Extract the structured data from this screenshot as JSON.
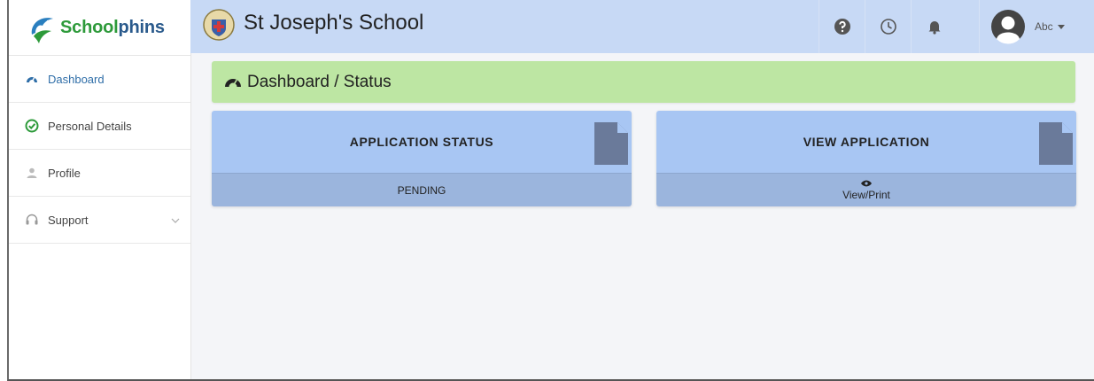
{
  "brand": {
    "part1": "School",
    "part2": "phins"
  },
  "header": {
    "school_name": "St Joseph's School",
    "user_name": "Abc"
  },
  "sidebar": {
    "items": [
      {
        "label": "Dashboard",
        "icon": "dashboard-icon",
        "active": true
      },
      {
        "label": "Personal Details",
        "icon": "check-circle-icon"
      },
      {
        "label": "Profile",
        "icon": "user-icon"
      },
      {
        "label": "Support",
        "icon": "headset-icon"
      }
    ]
  },
  "main": {
    "breadcrumb": "Dashboard / Status",
    "cards": [
      {
        "title": "APPLICATION STATUS",
        "value": "PENDING"
      },
      {
        "title": "VIEW APPLICATION",
        "value": "View/Print"
      }
    ]
  },
  "colors": {
    "header_bg": "#c7d9f5",
    "status_bar_bg": "#bde6a3",
    "card_top_bg": "#a8c6f3",
    "card_bottom_bg": "#9bb5dd",
    "accent": "#2f6ea8"
  }
}
